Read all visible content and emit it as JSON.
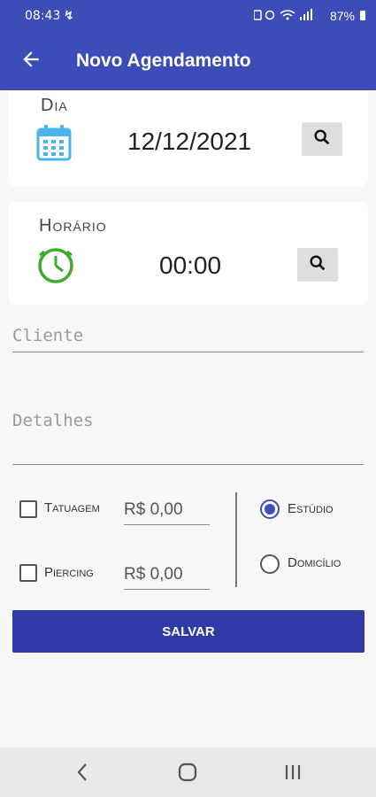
{
  "status_bar": {
    "time": "08:43",
    "left_icon": "notification-icon",
    "right_icons": "wifi-icon signal-icon",
    "battery_percent": "87%"
  },
  "app_bar": {
    "title": "Novo Agendamento",
    "back_icon": "arrow-back-icon"
  },
  "dia": {
    "label": "Dia",
    "value": "12/12/2021",
    "icon": "calendar-icon",
    "search_icon": "search-icon"
  },
  "horario": {
    "label": "Horário",
    "value": "00:00",
    "icon": "clock-icon",
    "search_icon": "search-icon"
  },
  "cliente": {
    "placeholder": "Cliente"
  },
  "detalhes": {
    "placeholder": "Detalhes"
  },
  "services": [
    {
      "label": "Tatuagem",
      "price": "R$ 0,00",
      "checked": false
    },
    {
      "label": "Piercing",
      "price": "R$ 0,00",
      "checked": false
    }
  ],
  "location": [
    {
      "label": "Estúdio",
      "selected": true
    },
    {
      "label": "Domicílio",
      "selected": false
    }
  ],
  "save_label": "SALVAR",
  "colors": {
    "primary": "#3d4db7",
    "button": "#2f3aa6",
    "calendar": "#4ab3e8",
    "clock": "#43a82f"
  }
}
